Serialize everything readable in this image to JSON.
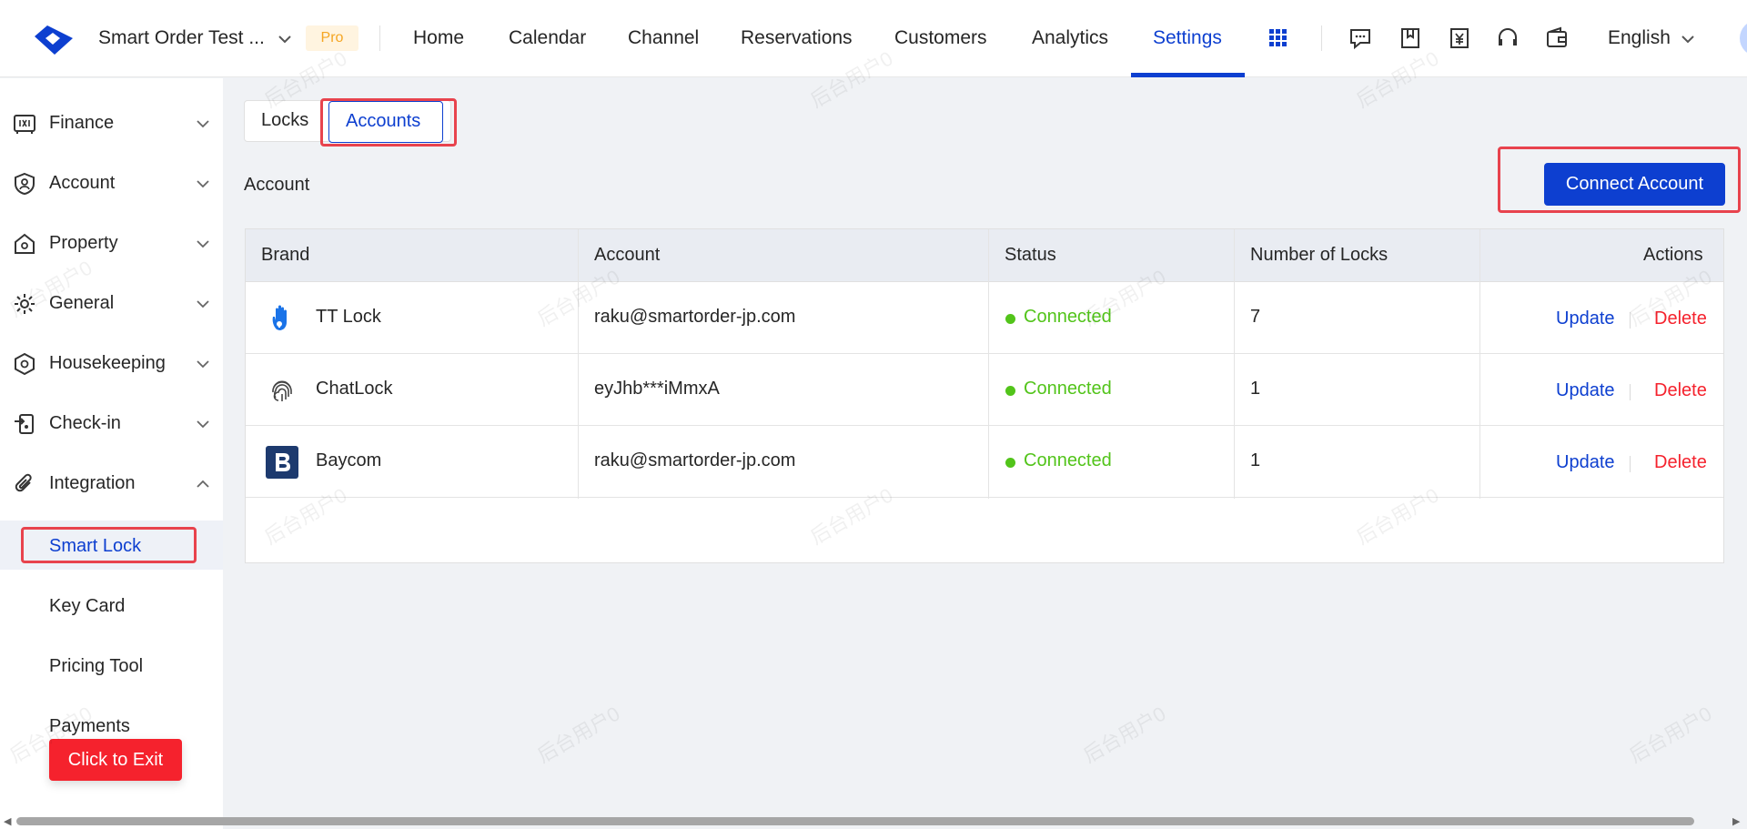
{
  "header": {
    "store_name": "Smart Order Test ...",
    "badge": "Pro",
    "nav": [
      "Home",
      "Calendar",
      "Channel",
      "Reservations",
      "Customers",
      "Analytics",
      "Settings"
    ],
    "active_nav": "Settings",
    "language": "English"
  },
  "sidebar": {
    "items": [
      {
        "label": "Finance",
        "icon": "safe-icon"
      },
      {
        "label": "Account",
        "icon": "user-shield-icon"
      },
      {
        "label": "Property",
        "icon": "home-icon"
      },
      {
        "label": "General",
        "icon": "gear-icon"
      },
      {
        "label": "Housekeeping",
        "icon": "hexagon-icon"
      },
      {
        "label": "Check-in",
        "icon": "checkin-icon"
      },
      {
        "label": "Integration",
        "icon": "paperclip-icon"
      }
    ],
    "integration_sub": [
      "Smart Lock",
      "Key Card",
      "Pricing Tool",
      "Payments"
    ],
    "active_sub": "Smart Lock"
  },
  "exit_button": "Click to Exit",
  "tabs": {
    "locks": "Locks",
    "accounts": "Accounts",
    "active": "Accounts"
  },
  "section_title": "Account",
  "connect_button": "Connect Account",
  "table": {
    "headers": [
      "Brand",
      "Account",
      "Status",
      "Number of Locks",
      "Actions"
    ],
    "rows": [
      {
        "brand": "TT Lock",
        "brand_icon": "tt-lock-hand-icon",
        "account": "raku@smartorder-jp.com",
        "status": "Connected",
        "locks": "7",
        "update": "Update",
        "delete": "Delete"
      },
      {
        "brand": "ChatLock",
        "brand_icon": "fingerprint-icon",
        "account": "eyJhb***iMmxA",
        "status": "Connected",
        "locks": "1",
        "update": "Update",
        "delete": "Delete"
      },
      {
        "brand": "Baycom",
        "brand_icon": "baycom-b-icon",
        "account": "raku@smartorder-jp.com",
        "status": "Connected",
        "locks": "1",
        "update": "Update",
        "delete": "Delete"
      }
    ]
  },
  "colors": {
    "primary": "#0d3fd0",
    "success": "#52c41a",
    "danger": "#f5222d",
    "highlight": "#e8434d"
  },
  "watermark": "后台用户0"
}
